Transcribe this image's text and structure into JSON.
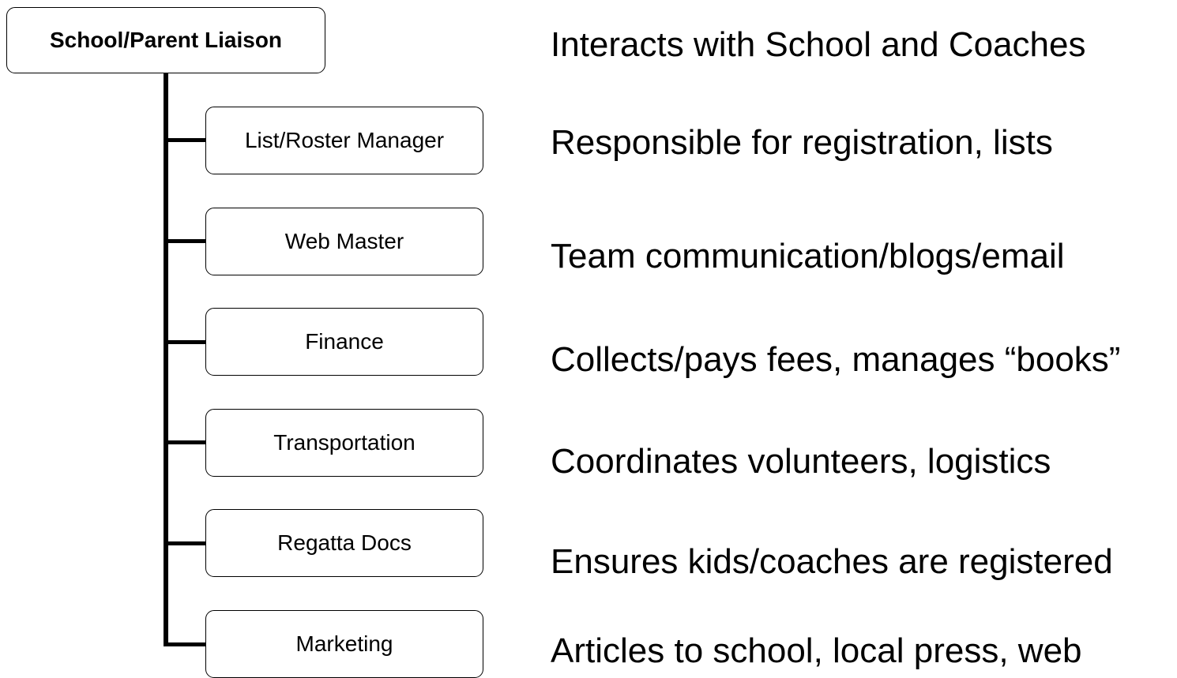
{
  "root": {
    "label": "School/Parent Liaison",
    "description": "Interacts with School and Coaches"
  },
  "roles": [
    {
      "label": "List/Roster Manager",
      "description": "Responsible for registration, lists"
    },
    {
      "label": "Web Master",
      "description": "Team communication/blogs/email"
    },
    {
      "label": "Finance",
      "description": "Collects/pays fees, manages “books”"
    },
    {
      "label": "Transportation",
      "description": "Coordinates volunteers, logistics"
    },
    {
      "label": "Regatta Docs",
      "description": "Ensures kids/coaches are registered"
    },
    {
      "label": "Marketing",
      "description": "Articles to school, local press, web"
    }
  ]
}
